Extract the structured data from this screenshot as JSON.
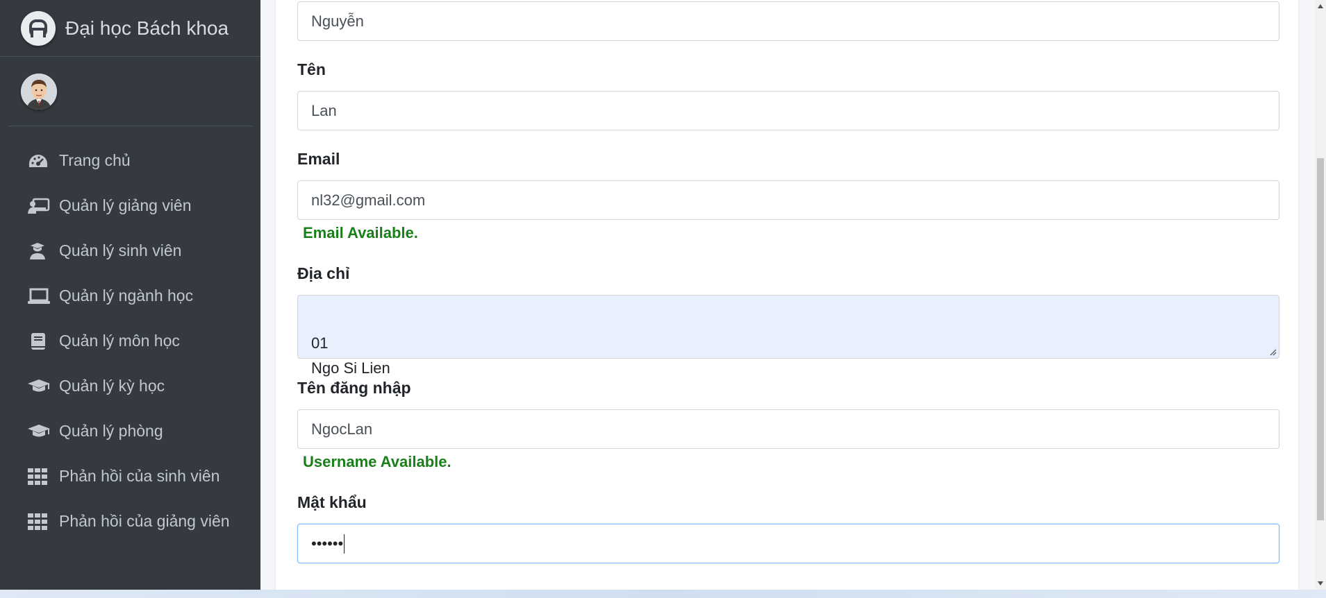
{
  "app": {
    "brand_name": "Đại học Bách khoa"
  },
  "sidebar": {
    "items": [
      {
        "label": "Trang chủ",
        "icon": "dashboard-icon"
      },
      {
        "label": "Quản lý giảng viên",
        "icon": "teacher-icon"
      },
      {
        "label": "Quản lý sinh viên",
        "icon": "student-icon"
      },
      {
        "label": "Quản lý ngành học",
        "icon": "laptop-icon"
      },
      {
        "label": "Quản lý môn học",
        "icon": "book-icon"
      },
      {
        "label": "Quản lý kỳ học",
        "icon": "graduation-cap-icon"
      },
      {
        "label": "Quản lý phòng",
        "icon": "graduation-cap-icon"
      },
      {
        "label": "Phản hồi của sinh viên",
        "icon": "grid-icon"
      },
      {
        "label": "Phản hồi của giảng viên",
        "icon": "grid-icon"
      }
    ]
  },
  "form": {
    "last_name_value": "Nguyễn",
    "first_name_label": "Tên",
    "first_name_value": "Lan",
    "email_label": "Email",
    "email_value": "nl32@gmail.com",
    "email_status": "Email Available.",
    "address_label": "Địa chỉ",
    "address_value": "01\nNgo Si Lien",
    "username_label": "Tên đăng nhập",
    "username_value": "NgocLan",
    "username_status": "Username Available.",
    "password_label": "Mật khẩu",
    "password_value": "••••••"
  },
  "colors": {
    "sidebar_bg": "#343a40",
    "success_text": "#198019",
    "autofill_bg": "#e8f0fe",
    "focus_border": "#80bdff"
  }
}
